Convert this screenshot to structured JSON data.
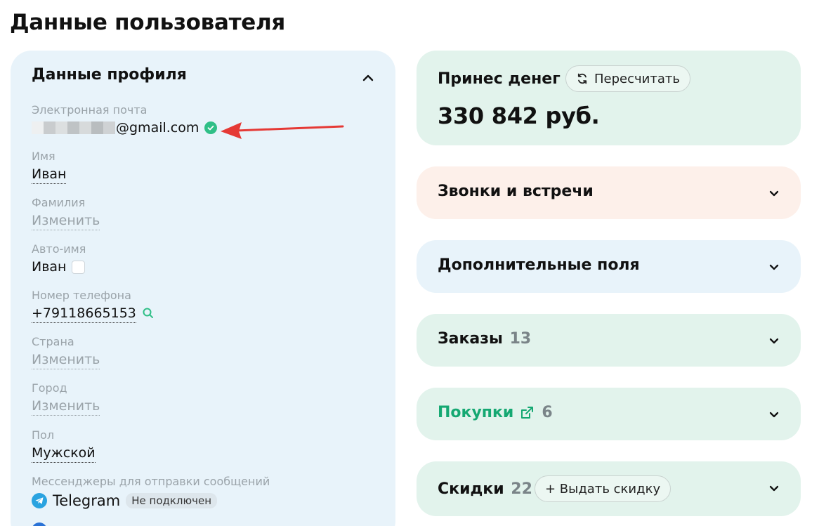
{
  "page": {
    "title": "Данные пользователя"
  },
  "profile": {
    "title": "Данные профиля",
    "email_label": "Электронная почта",
    "email_value": "@gmail.com",
    "name_label": "Имя",
    "name_value": "Иван",
    "surname_label": "Фамилия",
    "surname_value": "Изменить",
    "autoname_label": "Авто-имя",
    "autoname_value": "Иван",
    "phone_label": "Номер телефона",
    "phone_value": "+79118665153",
    "country_label": "Страна",
    "country_value": "Изменить",
    "city_label": "Город",
    "city_value": "Изменить",
    "gender_label": "Пол",
    "gender_value": "Мужской",
    "messengers_label": "Мессенджеры для отправки сообщений",
    "telegram_name": "Telegram",
    "telegram_status": "Не подключен"
  },
  "money": {
    "title": "Принес денег",
    "recalc_label": "Пересчитать",
    "value": "330 842 руб."
  },
  "sections": {
    "calls": "Звонки и встречи",
    "extra": "Дополнительные поля",
    "orders": "Заказы",
    "orders_count": "13",
    "purchases": "Покупки",
    "purchases_count": "6",
    "discounts": "Скидки",
    "discounts_count": "22",
    "issue_discount": "+ Выдать скидку"
  },
  "colors": {
    "accent_green": "#15a872",
    "verified_green": "#2fbf87",
    "annotation_red": "#e53935",
    "telegram_blue": "#2aa3e0"
  }
}
